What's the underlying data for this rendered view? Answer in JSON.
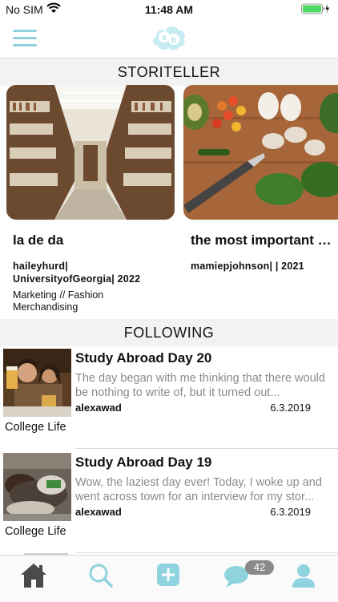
{
  "status_bar": {
    "carrier": "No SIM",
    "time": "11:48 AM"
  },
  "nav": {
    "logo_text": "STORIBLOCK"
  },
  "sections": {
    "storiteller": "STORITELLER",
    "following": "FOLLOWING"
  },
  "stories": [
    {
      "title": "la de da",
      "author": "haileyhurd| UniversityofGeorgia| 2022",
      "major": "Marketing // Fashion Merchandising",
      "image": "library-photo"
    },
    {
      "title": "the most important p...",
      "author": "mamiepjohnson| | 2021",
      "major": "",
      "image": "food-photo"
    }
  ],
  "feed": [
    {
      "title": "Study Abroad Day 20",
      "excerpt": "The day began with me thinking that there would be nothing to write of, but it turned out...",
      "author": "alexawad",
      "date": "6.3.2019",
      "category": "College Life",
      "image": "friends-photo"
    },
    {
      "title": "Study Abroad Day 19",
      "excerpt": "Wow, the laziest day ever! Today, I woke up and went across town for an interview for my stor...",
      "author": "alexawad",
      "date": "6.3.2019",
      "category": "College Life",
      "image": "resting-photo"
    }
  ],
  "tab_bar": {
    "messages_badge": "42"
  },
  "colors": {
    "accent": "#8fd3de",
    "home_active": "#4a4a4a",
    "section_bg": "#f2f2f2",
    "battery": "#4cd964"
  }
}
